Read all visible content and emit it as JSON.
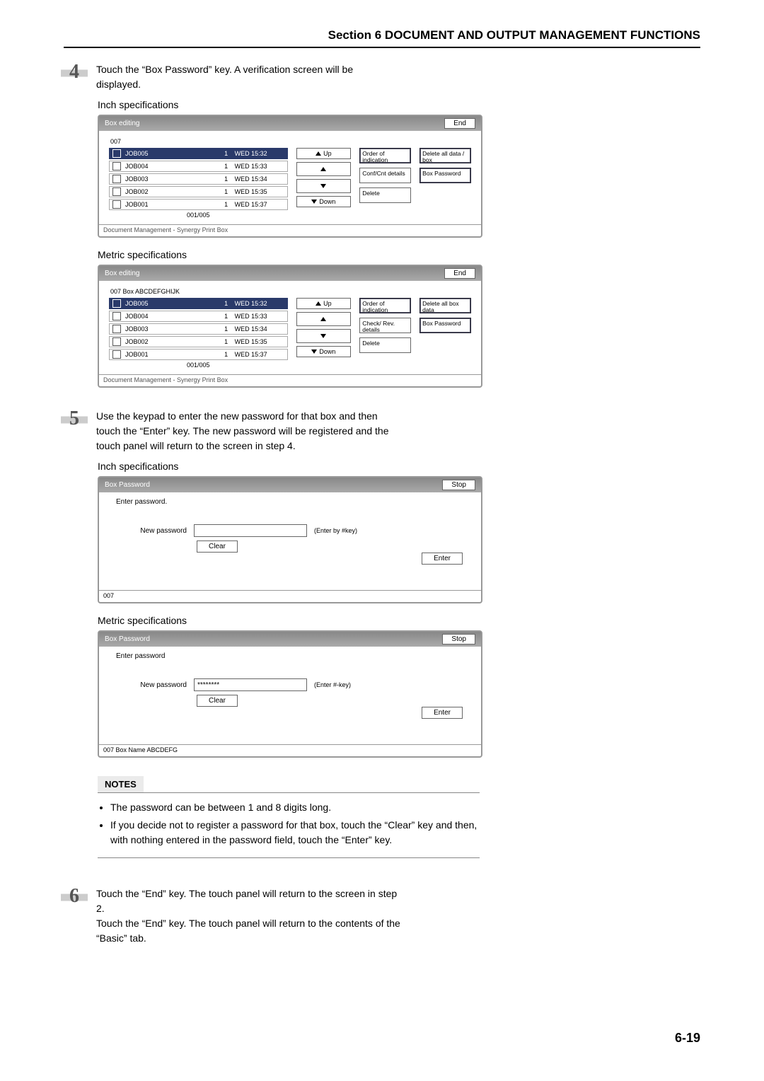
{
  "header": "Section 6  DOCUMENT AND OUTPUT MANAGEMENT FUNCTIONS",
  "step4": {
    "num": "4",
    "text": "Touch the “Box Password” key. A verification screen will be displayed.",
    "inch_label": "Inch specifications",
    "metric_label": "Metric specifications",
    "panel_title": "Box editing",
    "end_label": "End",
    "inch_boxid": "007",
    "metric_boxid": "007 Box ABCDEFGHIJK",
    "jobs": [
      {
        "name": "JOB005",
        "cnt": "1",
        "time": "WED 15:32",
        "sel": true
      },
      {
        "name": "JOB004",
        "cnt": "1",
        "time": "WED 15:33",
        "sel": false
      },
      {
        "name": "JOB003",
        "cnt": "1",
        "time": "WED 15:34",
        "sel": false
      },
      {
        "name": "JOB002",
        "cnt": "1",
        "time": "WED 15:35",
        "sel": false
      },
      {
        "name": "JOB001",
        "cnt": "1",
        "time": "WED 15:37",
        "sel": false
      }
    ],
    "counter": "001/005",
    "up": "Up",
    "down": "Down",
    "order_inch": "Order of indication",
    "order_metric": "Order of indication",
    "conf_inch": "Conf/Cnt details",
    "conf_metric": "Check/ Rev. details",
    "delete": "Delete",
    "del_all_inch": "Delete all data / box",
    "del_all_metric": "Delete all box data",
    "box_pw": "Box Password",
    "footer": "Document Management - Synergy Print Box"
  },
  "step5": {
    "num": "5",
    "text": "Use the keypad to enter the new password for that box and then touch the “Enter” key. The new password will be registered and the touch panel will return to the screen in step 4.",
    "inch_label": "Inch specifications",
    "metric_label": "Metric specifications",
    "panel_title": "Box Password",
    "stop": "Stop",
    "hint_inch": "Enter password.",
    "hint_metric": "Enter password",
    "newpw": "New password",
    "note_inch": "(Enter by #key)",
    "note_metric": "(Enter #-key)",
    "clear": "Clear",
    "enter": "Enter",
    "masked": "********",
    "foot_inch": "007",
    "foot_metric": "007   Box Name ABCDEFG"
  },
  "notes": {
    "head": "NOTES",
    "l1": "The password can be between 1 and 8 digits long.",
    "l2": "If you decide not to register a password for that box, touch the “Clear” key and then, with nothing entered in the password field, touch the “Enter” key."
  },
  "step6": {
    "num": "6",
    "text1": "Touch the “End” key. The touch panel will return to the screen in step 2.",
    "text2": "Touch the “End” key. The touch panel will return to the contents of the “Basic” tab."
  },
  "page_num": "6-19"
}
